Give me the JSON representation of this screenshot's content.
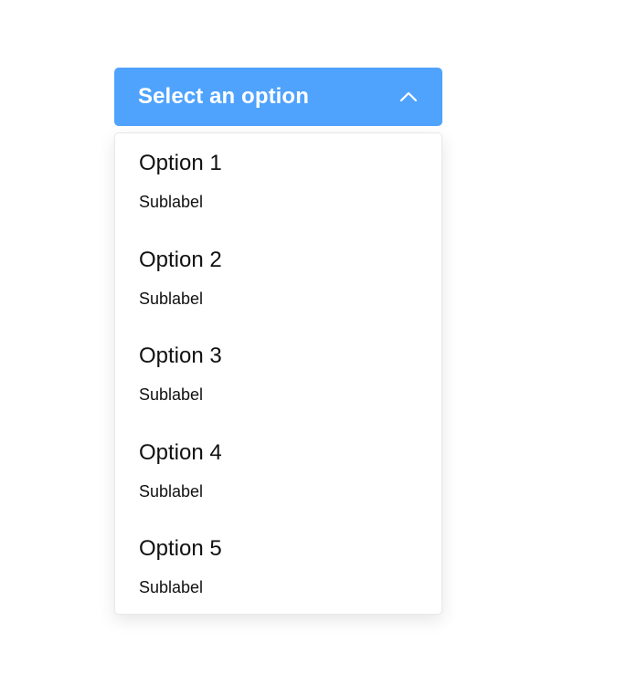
{
  "select": {
    "placeholder": "Select an option",
    "chevron_icon": "chevron-up-icon",
    "accent_color": "#4fa3fd",
    "expanded": true
  },
  "options": [
    {
      "label": "Option 1",
      "sublabel": "Sublabel"
    },
    {
      "label": "Option 2",
      "sublabel": "Sublabel"
    },
    {
      "label": "Option 3",
      "sublabel": "Sublabel"
    },
    {
      "label": "Option 4",
      "sublabel": "Sublabel"
    },
    {
      "label": "Option 5",
      "sublabel": "Sublabel"
    }
  ]
}
